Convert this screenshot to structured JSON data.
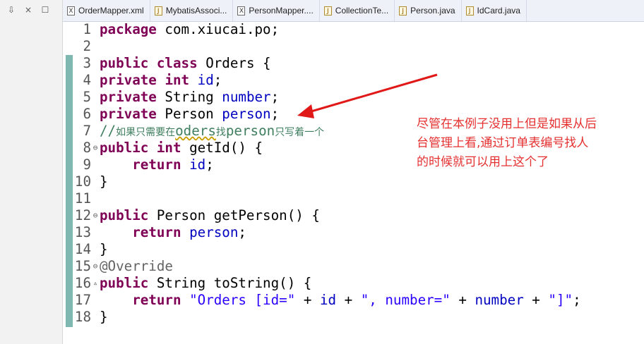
{
  "window_controls": [
    "⇩",
    "×",
    "☐"
  ],
  "tabs": [
    {
      "label": "OrderMapper.xml",
      "type": "xml"
    },
    {
      "label": "MybatisAssoci...",
      "type": "java"
    },
    {
      "label": "PersonMapper....",
      "type": "xml"
    },
    {
      "label": "CollectionTe...",
      "type": "java"
    },
    {
      "label": "Person.java",
      "type": "java"
    },
    {
      "label": "IdCard.java",
      "type": "java"
    }
  ],
  "code_lines": [
    {
      "n": "1",
      "fold": "",
      "html": "<span class=\"kw\">package</span> com.xiucai.po;"
    },
    {
      "n": "2",
      "fold": "",
      "html": ""
    },
    {
      "n": "3",
      "fold": "",
      "html": "<span class=\"kw\">public</span> <span class=\"kw\">class</span> Orders {"
    },
    {
      "n": "4",
      "fold": "",
      "html": "<span class=\"kw\">private</span> <span class=\"kw\">int</span> <span class=\"fld\">id</span>;"
    },
    {
      "n": "5",
      "fold": "",
      "html": "<span class=\"kw\">private</span> String <span class=\"fld\">number</span>;"
    },
    {
      "n": "6",
      "fold": "",
      "html": "<span class=\"kw\">private</span> Person <span class=\"fld\">person</span>;"
    },
    {
      "n": "7",
      "fold": "",
      "html": "<span class=\"cmt\">//<span class=\"cjk\">如果只需要在</span><span class=\"wavy\">oders</span><span class=\"cjk\">找</span>person<span class=\"cjk\">只写着一个</span></span>"
    },
    {
      "n": "8",
      "fold": "⊖",
      "html": "<span class=\"kw\">public</span> <span class=\"kw\">int</span> getId() {"
    },
    {
      "n": "9",
      "fold": "",
      "html": "    <span class=\"kw\">return</span> <span class=\"fld\">id</span>;"
    },
    {
      "n": "10",
      "fold": "",
      "html": "}"
    },
    {
      "n": "11",
      "fold": "",
      "html": ""
    },
    {
      "n": "12",
      "fold": "⊖",
      "html": "<span class=\"kw\">public</span> Person getPerson() {"
    },
    {
      "n": "13",
      "fold": "",
      "html": "    <span class=\"kw\">return</span> <span class=\"fld\">person</span>;"
    },
    {
      "n": "14",
      "fold": "",
      "html": "}"
    },
    {
      "n": "15",
      "fold": "⊖",
      "html": "<span class=\"ann\">@Override</span>"
    },
    {
      "n": "16",
      "fold": "▵",
      "html": "<span class=\"kw\">public</span> String toString() {"
    },
    {
      "n": "17",
      "fold": "",
      "html": "    <span class=\"kw\">return</span> <span class=\"str\">\"Orders [id=\"</span> + <span class=\"fld\">id</span> + <span class=\"str\">\", number=\"</span> + <span class=\"fld\">number</span> + <span class=\"str\">\"]\"</span>;"
    },
    {
      "n": "18",
      "fold": "",
      "html": "}"
    }
  ],
  "annotation": {
    "lines": [
      "尽管在本例子没用上但是如果从后",
      "台管理上看,通过订单表编号找人",
      "的时候就可以用上这个了"
    ],
    "color": "#e53030"
  },
  "syntax_colors": {
    "keyword": "#7f0055",
    "field": "#0000c0",
    "string": "#2a00ff",
    "comment": "#3f7f5f"
  }
}
